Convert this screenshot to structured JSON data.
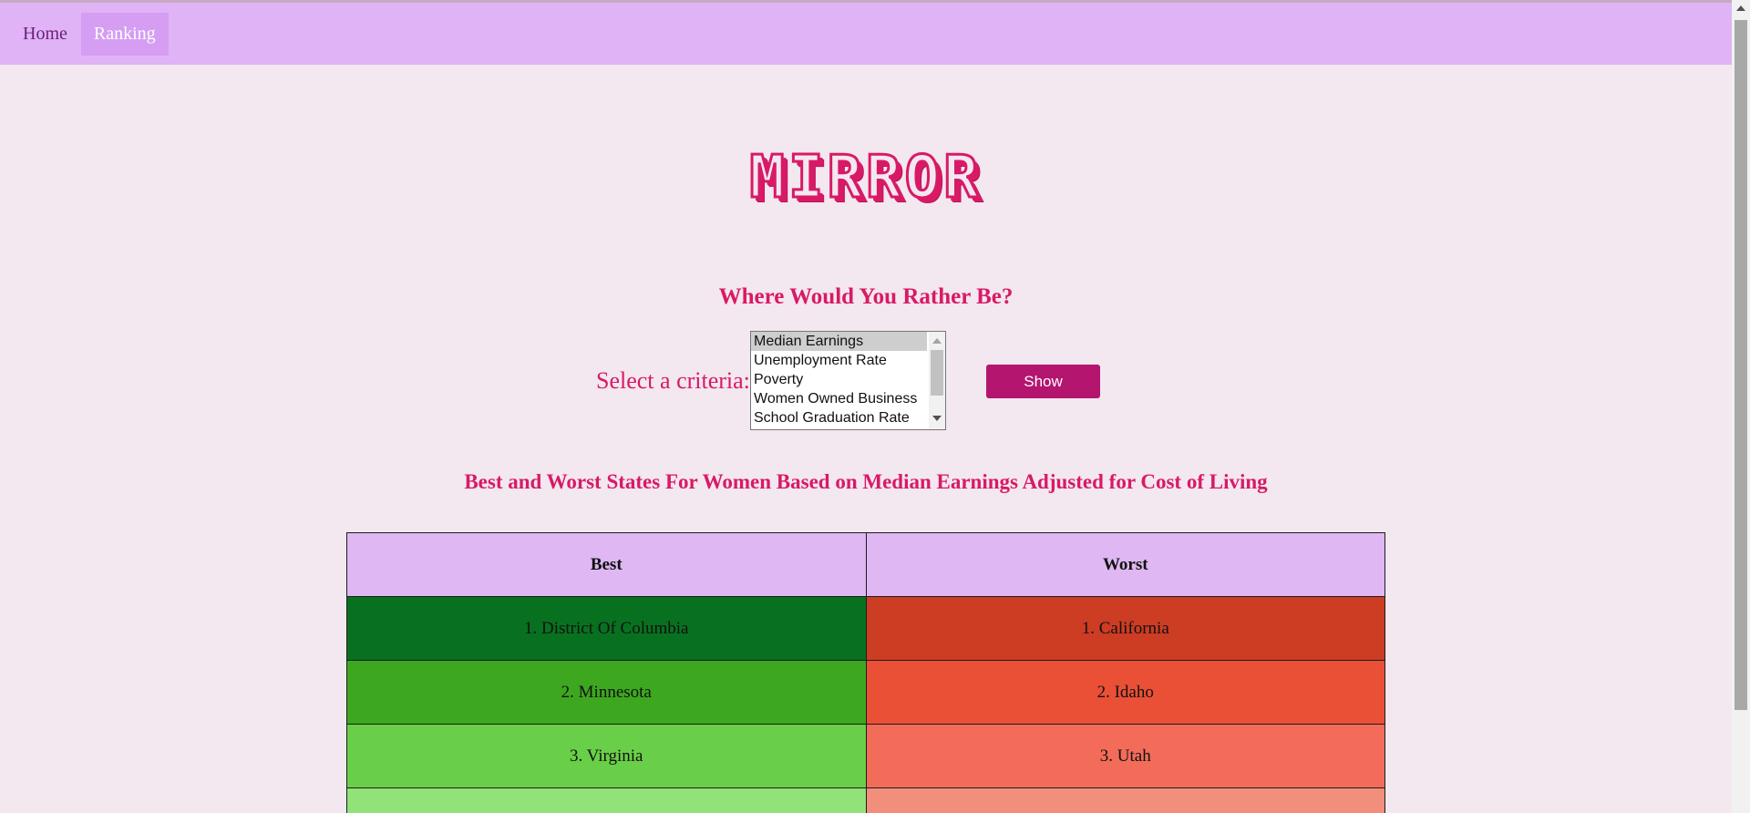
{
  "nav": {
    "items": [
      {
        "label": "Home",
        "active": false
      },
      {
        "label": "Ranking",
        "active": true
      }
    ],
    "colors": {
      "bar": "#dfb3f5",
      "active": "#d59ef2"
    }
  },
  "logo": {
    "text": "MIRROR",
    "color": "#d81a66"
  },
  "page": {
    "subtitle": "Where Would You Rather Be?"
  },
  "criteria": {
    "label": "Select a criteria:",
    "options": [
      "Median Earnings",
      "Unemployment Rate",
      "Poverty",
      "Women Owned Business",
      "School Graduation Rate"
    ],
    "selected": "Median Earnings",
    "show_label": "Show"
  },
  "results": {
    "title": "Best and Worst States For Women Based on Median Earnings Adjusted for Cost of Living",
    "headers": {
      "best": "Best",
      "worst": "Worst"
    },
    "rows": [
      {
        "best": "1. District Of Columbia",
        "worst": "1. California",
        "best_color": "#087120",
        "worst_color": "#cc3d24"
      },
      {
        "best": "2. Minnesota",
        "worst": "2. Idaho",
        "best_color": "#3ea720",
        "worst_color": "#ea5036"
      },
      {
        "best": "3. Virginia",
        "worst": "3. Utah",
        "best_color": "#6acf48",
        "worst_color": "#f26c59"
      },
      {
        "best": "",
        "worst": "",
        "best_color": "#92e27a",
        "worst_color": "#f18f7c"
      }
    ]
  }
}
